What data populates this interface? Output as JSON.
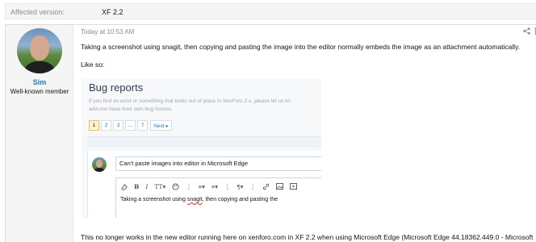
{
  "affected": {
    "label": "Affected version:",
    "value": "XF 2.2"
  },
  "user": {
    "name": "Sim",
    "title": "Well-known member"
  },
  "message": {
    "date": "Today at 10:53 AM",
    "para1": "Taking a screenshot using snagit, then copying and pasting the image into the editor normally embeds the image as an attachment automatically.",
    "para2": "Like so:",
    "para3": "This no longer works in the new editor running here on xenforo.com in XF 2.2 when using Microsoft Edge (Microsoft Edge 44.18362.449.0 - Microsoft"
  },
  "screenshot": {
    "title": "Bug reports",
    "desc_line1": "If you find an error or something that looks out of place in XenForo 2.x, please let us kn",
    "desc_line2": "add-ons have their own bug forums.",
    "pages": [
      "1",
      "2",
      "3",
      "...",
      "7"
    ],
    "next_label": "Next ▸",
    "thread_title": "Can't paste images into editor in Microsoft Edge",
    "editor_prefix": "Taking a screenshot using ",
    "editor_misspelled": "snagit",
    "editor_suffix": ", then copying and pasting the",
    "toolbar_icons": [
      "eraser-icon",
      "bold-icon",
      "italic-icon",
      "text-size-icon",
      "palette-icon",
      "more-icon",
      "list-icon",
      "align-icon",
      "paragraph-icon",
      "link-icon",
      "image-icon",
      "media-icon"
    ]
  },
  "colors": {
    "link": "#2577b1",
    "muted": "#8c8c8c",
    "panel": "#f5f5f5"
  }
}
